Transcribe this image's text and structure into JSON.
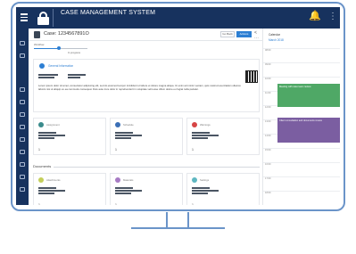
{
  "app": {
    "title": "CASE MANAGEMENT SYSTEM"
  },
  "case": {
    "title": "Case: 1234567891O",
    "back_label": "Go Back",
    "action_label": "Actions",
    "progress_label": "Workflow",
    "progress_state": "In progress",
    "progress_fraction": 0.45
  },
  "general": {
    "title": "General Information",
    "body": "Lorem ipsum dolor sit amet, consectetur adipiscing elit, sed do eiusmod tempor incididunt ut labore et dolore magna aliqua. Ut enim ad minim veniam, quis nostrud exercitation ullamco laboris nisi ut aliquip ex ea commodo consequat. Duis aute irure dolor in reprehenderit in voluptate velit esse cillum dolore eu fugiat nulla pariatur."
  },
  "cards_top": [
    {
      "title": "Assignment",
      "color": "#3a8b8c",
      "num": "1"
    },
    {
      "title": "Schedule",
      "color": "#3b6fb6",
      "num": "1"
    },
    {
      "title": "Warnings",
      "color": "#d64545",
      "num": "1"
    }
  ],
  "documents": {
    "label": "Documents"
  },
  "cards_bottom": [
    {
      "title": "Attachments",
      "color": "#c4cf5a",
      "num": "1"
    },
    {
      "title": "Materials",
      "color": "#a77bc4",
      "num": "1"
    },
    {
      "title": "Settings",
      "color": "#5fb7c1",
      "num": "1"
    }
  ],
  "calendar": {
    "header": "Calendar",
    "date": "March 2018",
    "times": [
      "08:00",
      "09:00",
      "10:00",
      "11:00",
      "12:00",
      "13:00",
      "14:00",
      "15:00",
      "16:00",
      "17:00",
      "18:00"
    ],
    "events": [
      {
        "text": "Meeting with case team review",
        "color": "#4fa866"
      },
      {
        "text": "Client consultation and documents review",
        "color": "#7b5ea1"
      }
    ]
  },
  "colors": {
    "topbar": "#17325e",
    "accent": "#2d7fd3",
    "frame": "#6b94c9"
  }
}
